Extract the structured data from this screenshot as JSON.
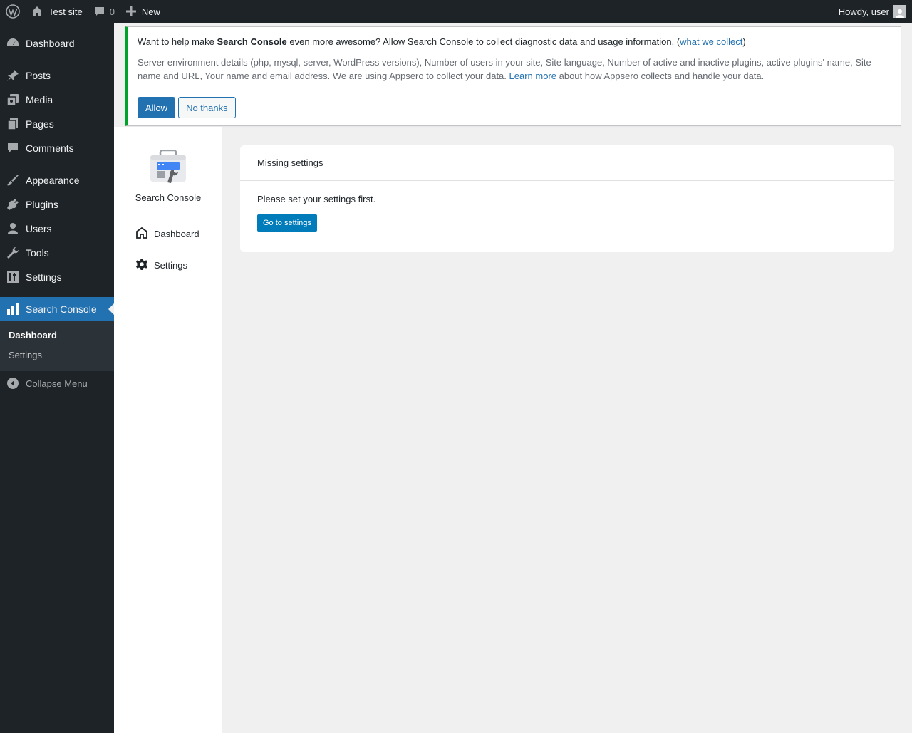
{
  "adminbar": {
    "site_name": "Test site",
    "comments_count": "0",
    "new_label": "New",
    "howdy": "Howdy, user"
  },
  "menu": {
    "items": [
      {
        "label": "Dashboard",
        "icon": "dashboard-icon"
      },
      {
        "label": "Posts",
        "icon": "pin-icon"
      },
      {
        "label": "Media",
        "icon": "media-icon"
      },
      {
        "label": "Pages",
        "icon": "pages-icon"
      },
      {
        "label": "Comments",
        "icon": "comments-icon"
      },
      {
        "label": "Appearance",
        "icon": "paintbrush-icon"
      },
      {
        "label": "Plugins",
        "icon": "plugin-icon"
      },
      {
        "label": "Users",
        "icon": "users-icon"
      },
      {
        "label": "Tools",
        "icon": "wrench-icon"
      },
      {
        "label": "Settings",
        "icon": "sliders-icon"
      },
      {
        "label": "Search Console",
        "icon": "chart-bar-icon"
      }
    ],
    "submenu": [
      "Dashboard",
      "Settings"
    ],
    "collapse": "Collapse Menu"
  },
  "notice": {
    "text_before": "Want to help make ",
    "plugin_name": "Search Console",
    "text_after": " even more awesome? Allow Search Console to collect diagnostic data and usage information. (",
    "what_we_collect": "what we collect",
    "close_paren": ")",
    "details": "Server environment details (php, mysql, server, WordPress versions), Number of users in your site, Site language, Number of active and inactive plugins, active plugins' name, Site name and URL, Your name and email address. We are using Appsero to collect your data. ",
    "learn_more": "Learn more",
    "details_after": " about how Appsero collects and handle your data.",
    "allow": "Allow",
    "no_thanks": "No thanks"
  },
  "plugin_nav": {
    "title": "Search Console",
    "items": [
      "Dashboard",
      "Settings"
    ]
  },
  "card": {
    "header": "Missing settings",
    "message": "Please set your settings first.",
    "button": "Go to settings"
  },
  "colors": {
    "adminbar_bg": "#1d2327",
    "accent": "#2271b1",
    "notice_border": "#00a32a"
  }
}
